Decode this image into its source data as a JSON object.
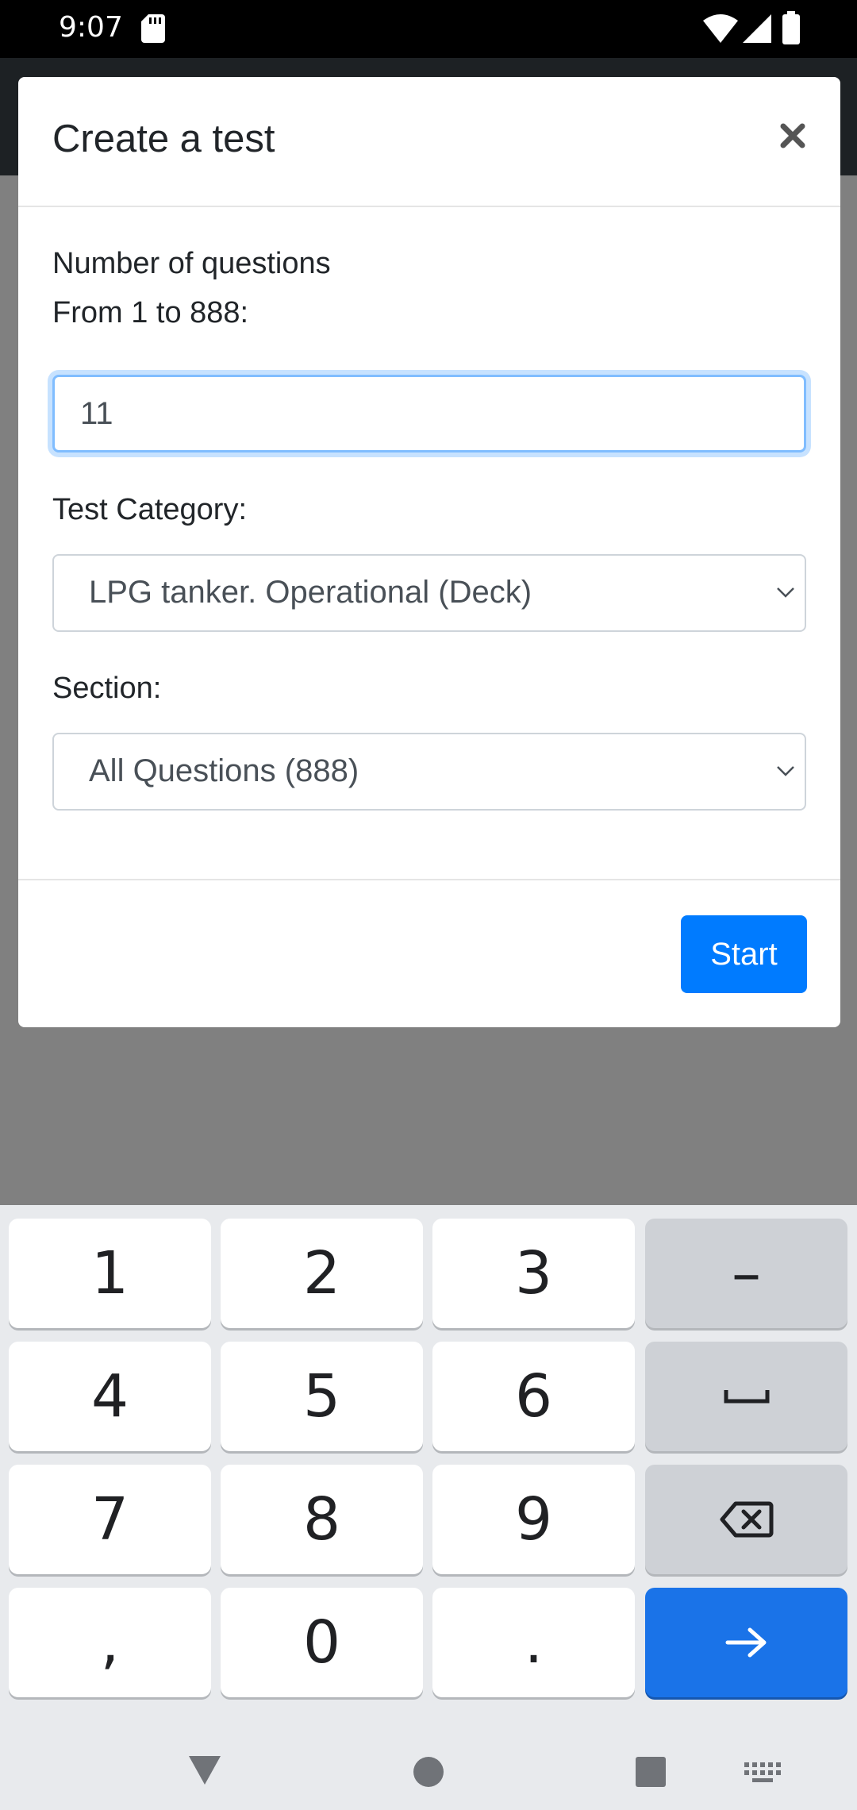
{
  "status_bar": {
    "time": "9:07",
    "icons": [
      "sd-card-icon",
      "wifi-icon",
      "signal-icon",
      "battery-icon"
    ]
  },
  "modal": {
    "title": "Create a test",
    "close_icon": "close-icon",
    "questions_label_line1": "Number of questions",
    "questions_label_line2": "From 1 to 888:",
    "questions_value": "11",
    "category_label": "Test Category:",
    "category_selected": "LPG tanker. Operational (Deck)",
    "section_label": "Section:",
    "section_selected": "All Questions (888)",
    "start_label": "Start"
  },
  "keyboard": {
    "keys": [
      "1",
      "2",
      "3",
      "–",
      "4",
      "5",
      "6",
      "space",
      "7",
      "8",
      "9",
      "backspace",
      ",",
      "0",
      ".",
      "enter"
    ],
    "labels": {
      "k1": "1",
      "k2": "2",
      "k3": "3",
      "dash": "–",
      "k4": "4",
      "k5": "5",
      "k6": "6",
      "k7": "7",
      "k8": "8",
      "k9": "9",
      "comma": ",",
      "k0": "0",
      "period": "."
    },
    "icons": [
      "space-icon",
      "backspace-icon",
      "arrow-right-icon"
    ]
  },
  "nav_bar": {
    "icons": [
      "back-icon",
      "home-icon",
      "recents-icon",
      "keyboard-icon"
    ]
  },
  "colors": {
    "primary": "#007bff",
    "focus_ring": "#80bdff",
    "keyboard_enter": "#1a73e8",
    "scrim": "#808080"
  }
}
